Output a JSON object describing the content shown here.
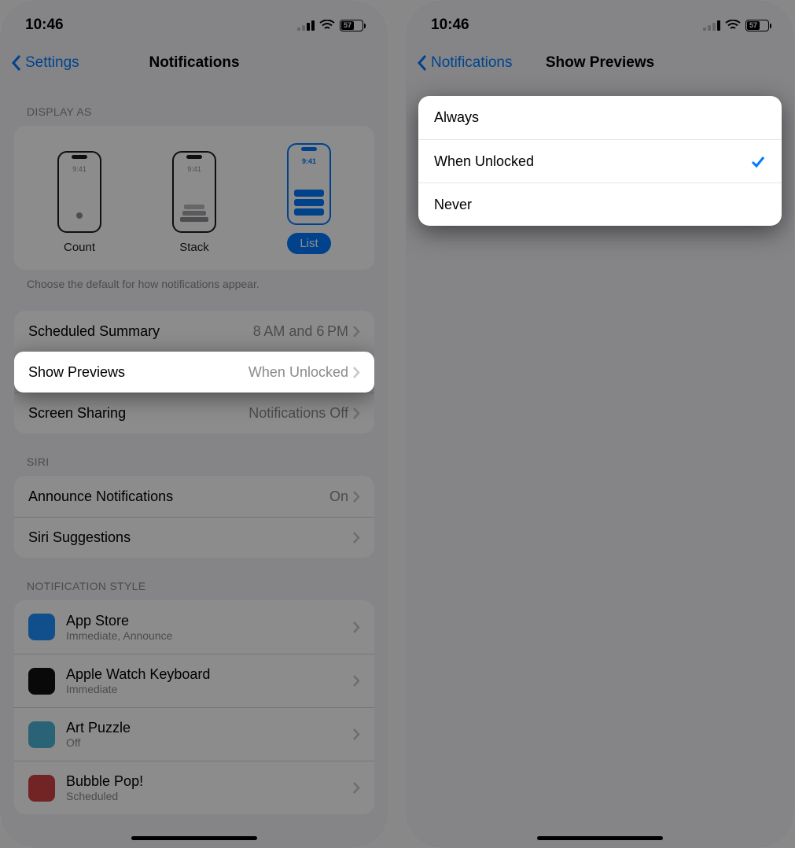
{
  "status": {
    "time": "10:46",
    "battery_pct": "57",
    "battery_fill_pct": 57
  },
  "left": {
    "nav": {
      "back": "Settings",
      "title": "Notifications"
    },
    "display_as": {
      "header": "DISPLAY AS",
      "mini_time": "9:41",
      "options": [
        {
          "label": "Count",
          "selected": false,
          "kind": "count"
        },
        {
          "label": "Stack",
          "selected": false,
          "kind": "stack"
        },
        {
          "label": "List",
          "selected": true,
          "kind": "list"
        }
      ],
      "footer": "Choose the default for how notifications appear."
    },
    "group1": [
      {
        "label": "Scheduled Summary",
        "value": "8 AM and 6 PM"
      },
      {
        "label": "Show Previews",
        "value": "When Unlocked",
        "highlight": true
      },
      {
        "label": "Screen Sharing",
        "value": "Notifications Off"
      }
    ],
    "siri_header": "SIRI",
    "siri": [
      {
        "label": "Announce Notifications",
        "value": "On"
      },
      {
        "label": "Siri Suggestions",
        "value": ""
      }
    ],
    "style_header": "NOTIFICATION STYLE",
    "apps": [
      {
        "name": "App Store",
        "sub": "Immediate, Announce",
        "color": "#1e90ff"
      },
      {
        "name": "Apple Watch Keyboard",
        "sub": "Immediate",
        "color": "#111"
      },
      {
        "name": "Art Puzzle",
        "sub": "Off",
        "color": "#4fb5d8"
      },
      {
        "name": "Bubble Pop!",
        "sub": "Scheduled",
        "color": "#d04040"
      }
    ]
  },
  "right": {
    "nav": {
      "back": "Notifications",
      "title": "Show Previews"
    },
    "options": [
      {
        "label": "Always",
        "selected": false
      },
      {
        "label": "When Unlocked",
        "selected": true
      },
      {
        "label": "Never",
        "selected": false
      }
    ]
  }
}
